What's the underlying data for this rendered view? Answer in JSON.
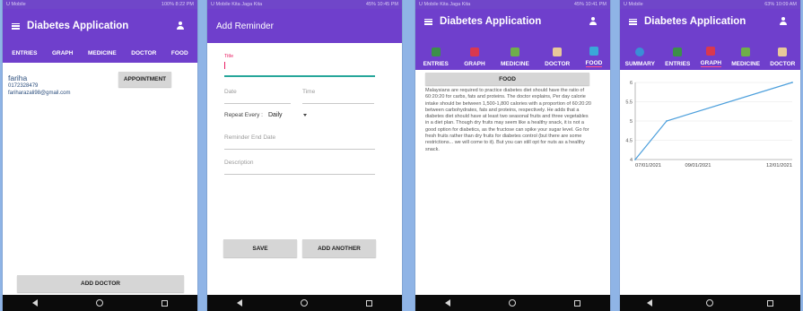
{
  "app_title": "Diabetes Application",
  "phone1": {
    "status_left": "U Mobile",
    "status_right": "100% 8:22 PM",
    "tabs": [
      "ENTRIES",
      "GRAPH",
      "MEDICINE",
      "DOCTOR",
      "FOOD"
    ],
    "doctor": {
      "name": "fariha",
      "phone": "0172328479",
      "email": "fariharazali98@gmail.com"
    },
    "appointment_label": "APPOINTMENT",
    "add_doctor_label": "ADD DOCTOR"
  },
  "phone2": {
    "status_left": "U Mobile Kita Jaga Kita",
    "status_right": "45% 10:45 PM",
    "title": "Add Reminder",
    "title_label": "Title",
    "date_label": "Date",
    "time_label": "Time",
    "repeat_label": "Repeat Every :",
    "repeat_value": "Daily",
    "end_date_label": "Reminder End Date",
    "description_label": "Description",
    "save_label": "SAVE",
    "add_another_label": "ADD ANOTHER"
  },
  "phone3": {
    "status_left": "U Mobile Kita Jaga Kita",
    "status_right": "45% 10:41 PM",
    "tabs": [
      "ENTRIES",
      "GRAPH",
      "MEDICINE",
      "DOCTOR",
      "FOOD"
    ],
    "food_button": "FOOD",
    "food_text": "Malaysians are required to practice diabetes diet should have the ratio of 60:20:20 for carbs, fats and proteins. The doctor explains, Per day calorie intake should be between 1,500-1,800 calories with a proportion of 60:20:20 between carbohydrates, fats and proteins, respectively. He adds that a diabetes diet should have at least two seasonal fruits and three vegetables in a diet plan. Though dry fruits may seem like a healthy snack, it is not a good option for diabetics, as the fructose can spike your sugar level. Go for fresh fruits rather than dry fruits for diabetes control (but there are some restrictions... we will come to it). But you can still opt for nuts as a healthy snack."
  },
  "phone4": {
    "status_left": "U Mobile",
    "status_right": "63% 10:09 AM",
    "tabs": [
      "SUMMARY",
      "ENTRIES",
      "GRAPH",
      "MEDICINE",
      "DOCTOR"
    ]
  },
  "colors": {
    "primary": "#6f3fcc",
    "accent": "#ff4f8b",
    "line": "#4c9fdc",
    "teal": "#26a69a"
  },
  "chart_data": {
    "type": "line",
    "x": [
      "07/01/2021",
      "08/01/2021",
      "12/01/2021"
    ],
    "x_ticks": [
      "07/01/2021",
      "09/01/2021",
      "12/01/2021"
    ],
    "y_ticks": [
      "4",
      "4.5",
      "5",
      "5.5",
      "6"
    ],
    "values": [
      4,
      5,
      6
    ],
    "ylim": [
      4,
      6
    ],
    "grid": true
  }
}
